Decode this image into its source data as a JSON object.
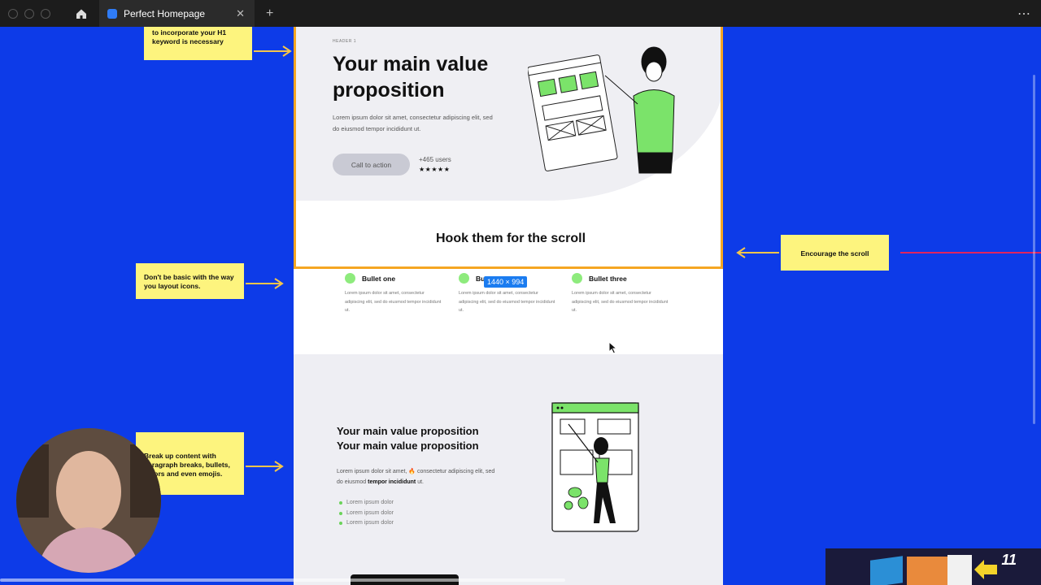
{
  "browser": {
    "tab_title": "Perfect Homepage",
    "tab_close": "✕",
    "new_tab": "+",
    "more": "⋯"
  },
  "hero": {
    "eyebrow": "HEADER 1",
    "title": "Your main value proposition",
    "description": "Lorem ipsum dolor sit amet, consectetur adipiscing elit, sed do eiusmod tempor incididunt ut.",
    "cta_label": "Call to action",
    "users_text": "+465 users",
    "stars": "★★★★★",
    "hook_title": "Hook them for the scroll"
  },
  "selection": {
    "size_label": "1440 × 994"
  },
  "bullets": [
    {
      "title": "Bullet one",
      "text": "Lorem ipsum dolor sit amet, consectetur adipiscing elit, sed do eiusmod tempor incididunt ut."
    },
    {
      "title": "Bullet two",
      "text": "Lorem ipsum dolor sit amet, consectetur adipiscing elit, sed do eiusmod tempor incididunt ut."
    },
    {
      "title": "Bullet three",
      "text": "Lorem ipsum dolor sit amet, consectetur adipiscing elit, sed do eiusmod tempor incididunt ut."
    }
  ],
  "section2": {
    "title_line1": "Your main value proposition",
    "title_line2": "Your main value proposition",
    "desc_before": "Lorem ipsum dolor sit amet, 🔥 consectetur adipiscing elit, sed do eiusmod ",
    "desc_bold": "tempor incididunt",
    "desc_after": " ut.",
    "list": [
      "Lorem ipsum dolor",
      "Lorem ipsum dolor",
      "Lorem ipsum dolor"
    ]
  },
  "annotations": {
    "h1_note": "to incorporate your H1 keyword is necessary",
    "icons_note": "Don't be basic with the way you layout icons.",
    "scroll_note": "Encourage the scroll",
    "content_note": "Break up content with paragraph breaks, bullets, colors and even emojis."
  },
  "thumbnail": {
    "number": "11"
  },
  "colors": {
    "canvas_blue": "#0d3be8",
    "note_yellow": "#fdf47e",
    "accent_green": "#8eeb7d",
    "selection_orange": "#f5a623",
    "size_badge_blue": "#1b7cf0"
  }
}
